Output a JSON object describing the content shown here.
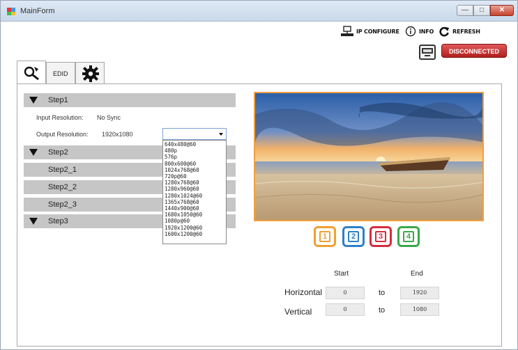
{
  "window": {
    "title": "MainForm",
    "controls": {
      "minimize": "—",
      "maximize": "□",
      "close": "✕"
    }
  },
  "toolbar": {
    "ip_configure": "IP CONFIGURE",
    "info": "INFO",
    "refresh": "REFRESH",
    "status": "DISCONNECTED",
    "status_color": "#c62828"
  },
  "tabs": [
    {
      "name": "settings",
      "icon": "wrench-icon"
    },
    {
      "name": "edid",
      "label": "EDID"
    },
    {
      "name": "gear",
      "icon": "gear-icon"
    }
  ],
  "steps": {
    "step1": "Step1",
    "step2": "Step2",
    "step2_1": "Step2_1",
    "step2_2": "Step2_2",
    "step2_3": "Step2_3",
    "step3": "Step3"
  },
  "resolution": {
    "input_label": "Input Resolution:",
    "input_value": "No Sync",
    "output_label": "Output Resolution:",
    "output_value": "1920x1080",
    "options": [
      "640x480@60",
      "480p",
      "576p",
      "800x600@60",
      "1024x768@60",
      "720p@60",
      "1280x768@60",
      "1280x960@60",
      "1280x1024@60",
      "1365x768@60",
      "1440x900@60",
      "1680x1050@60",
      "1080p@60",
      "1920x1200@60",
      "1600x1200@60"
    ]
  },
  "windows_selector": [
    {
      "label": "1",
      "color": "#f0a030"
    },
    {
      "label": "2",
      "color": "#2f7fc8"
    },
    {
      "label": "3",
      "color": "#d62c3c"
    },
    {
      "label": "4",
      "color": "#3aa84a"
    }
  ],
  "coords": {
    "start_header": "Start",
    "end_header": "End",
    "horizontal_label": "Horizontal",
    "vertical_label": "Vertical",
    "to": "to",
    "h_start": "0",
    "h_end": "1920",
    "v_start": "0",
    "v_end": "1080"
  }
}
